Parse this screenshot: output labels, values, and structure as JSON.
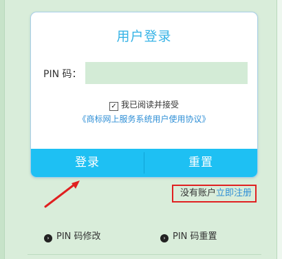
{
  "login": {
    "title": "用户登录",
    "pin_label": "PIN 码：",
    "pin_value": "",
    "agree_checked": true,
    "agree_text": "我已阅读并接受",
    "agreement_link": "《商标网上服务系统用户使用协议》",
    "login_button": "登录",
    "reset_button": "重置"
  },
  "register": {
    "no_account": "没有账户",
    "register_link": "立即注册"
  },
  "links": {
    "pin_modify": "PIN 码修改",
    "pin_reset": "PIN 码重置"
  },
  "colors": {
    "accent": "#1ec0f3",
    "title": "#36b3e6",
    "link": "#2f8fd6",
    "highlight": "#e02020",
    "background": "#d9edda"
  },
  "icons": {
    "checkbox": "check-icon",
    "link_bullet": "chevron-right-circle-icon",
    "annotation": "red-arrow-icon"
  }
}
